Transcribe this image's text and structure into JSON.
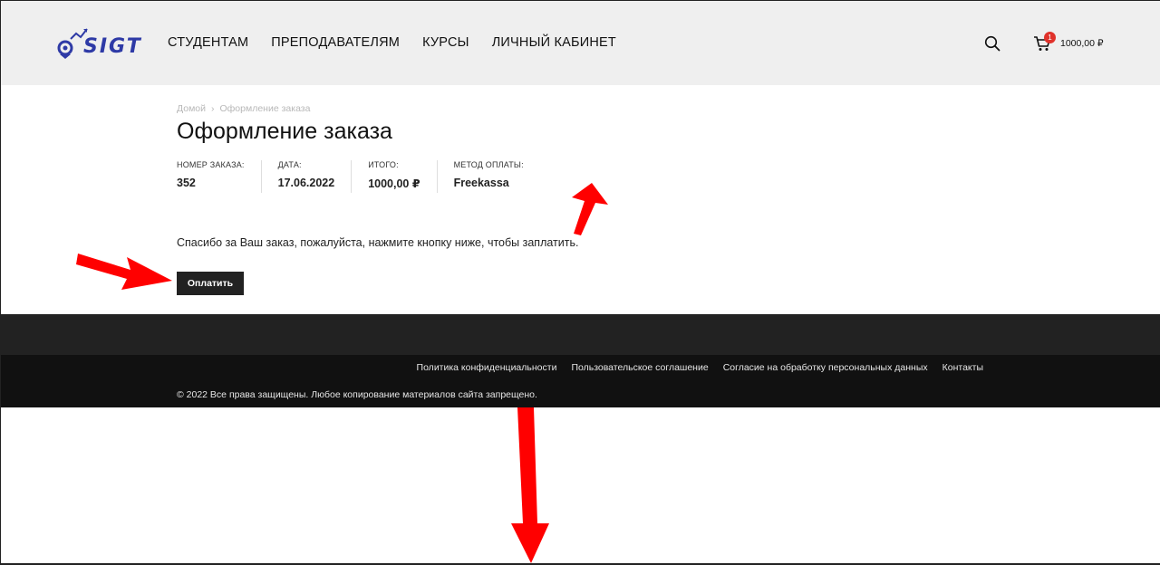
{
  "header": {
    "logo_text": "SIGT",
    "nav": [
      {
        "label": "СТУДЕНТАМ"
      },
      {
        "label": "ПРЕПОДАВАТЕЛЯМ"
      },
      {
        "label": "КУРСЫ"
      },
      {
        "label": "ЛИЧНЫЙ КАБИНЕТ"
      }
    ],
    "cart": {
      "count": "1",
      "total": "1000,00 ₽"
    }
  },
  "breadcrumb": {
    "home": "Домой",
    "sep": "›",
    "current": "Оформление заказа"
  },
  "page": {
    "title": "Оформление заказа"
  },
  "order": {
    "number_label": "НОМЕР ЗАКАЗА:",
    "number": "352",
    "date_label": "ДАТА:",
    "date": "17.06.2022",
    "total_label": "ИТОГО:",
    "total": "1000,00 ₽",
    "method_label": "МЕТОД ОПЛАТЫ:",
    "method": "Freekassa"
  },
  "message": "Спасибо за Ваш заказ, пожалуйста, нажмите кнопку ниже, чтобы заплатить.",
  "pay_button": "Оплатить",
  "footer": {
    "links": [
      "Политика конфиденциальности",
      "Пользовательское соглашение",
      "Согласие на обработку персональных данных",
      "Контакты"
    ],
    "copyright": "© 2022 Все права защищены. Любое копирование материалов сайта запрещено."
  },
  "colors": {
    "brand": "#2e3aa6",
    "header_bg": "#efefef",
    "badge": "#e0322b",
    "annotation": "#ff0000",
    "button_bg": "#222222"
  }
}
